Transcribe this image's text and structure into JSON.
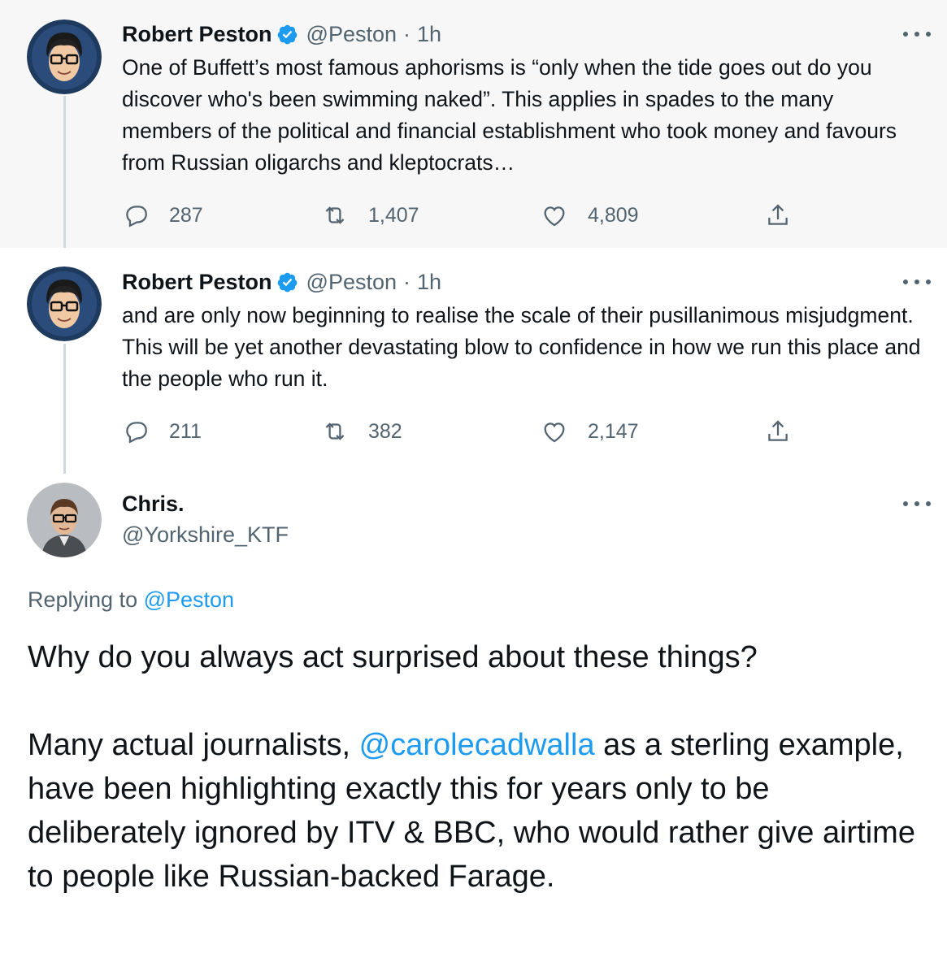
{
  "tweets": [
    {
      "author_name": "Robert Peston",
      "handle": "@Peston",
      "separator": "·",
      "time": "1h",
      "text": "One of Buffett’s most famous aphorisms is “only when the tide goes out do you discover who's been swimming naked”. This applies in spades to the many members of the political and financial establishment who took money and favours from Russian oligarchs and kleptocrats…",
      "replies": "287",
      "retweets": "1,407",
      "likes": "4,809"
    },
    {
      "author_name": "Robert Peston",
      "handle": "@Peston",
      "separator": "·",
      "time": "1h",
      "text": "and are only now beginning to realise the scale of their pusillanimous misjudgment. This will be yet another devastating blow to confidence in how we run this place and the people who run it.",
      "replies": "211",
      "retweets": "382",
      "likes": "2,147"
    }
  ],
  "reply_tweet": {
    "author_name": "Chris.",
    "handle": "@Yorkshire_KTF",
    "replying_prefix": "Replying to",
    "replying_to": "@Peston",
    "paragraph1": "Why do you always act surprised about these things?",
    "paragraph2_before": "Many actual journalists, ",
    "mention": "@carolecadwalla",
    "paragraph2_after": " as a sterling example, have been highlighting exactly this for years only to be deliberately ignored by ITV & BBC, who would rather give airtime to people like Russian-backed Farage."
  },
  "colors": {
    "accent": "#1d9bf0",
    "muted_text": "#536471",
    "highlight_bg": "#f7f7f7"
  },
  "icons": {
    "verified": "verified-badge-icon",
    "reply": "reply-icon",
    "retweet": "retweet-icon",
    "like": "heart-icon",
    "share": "share-icon",
    "more": "more-options-icon"
  }
}
